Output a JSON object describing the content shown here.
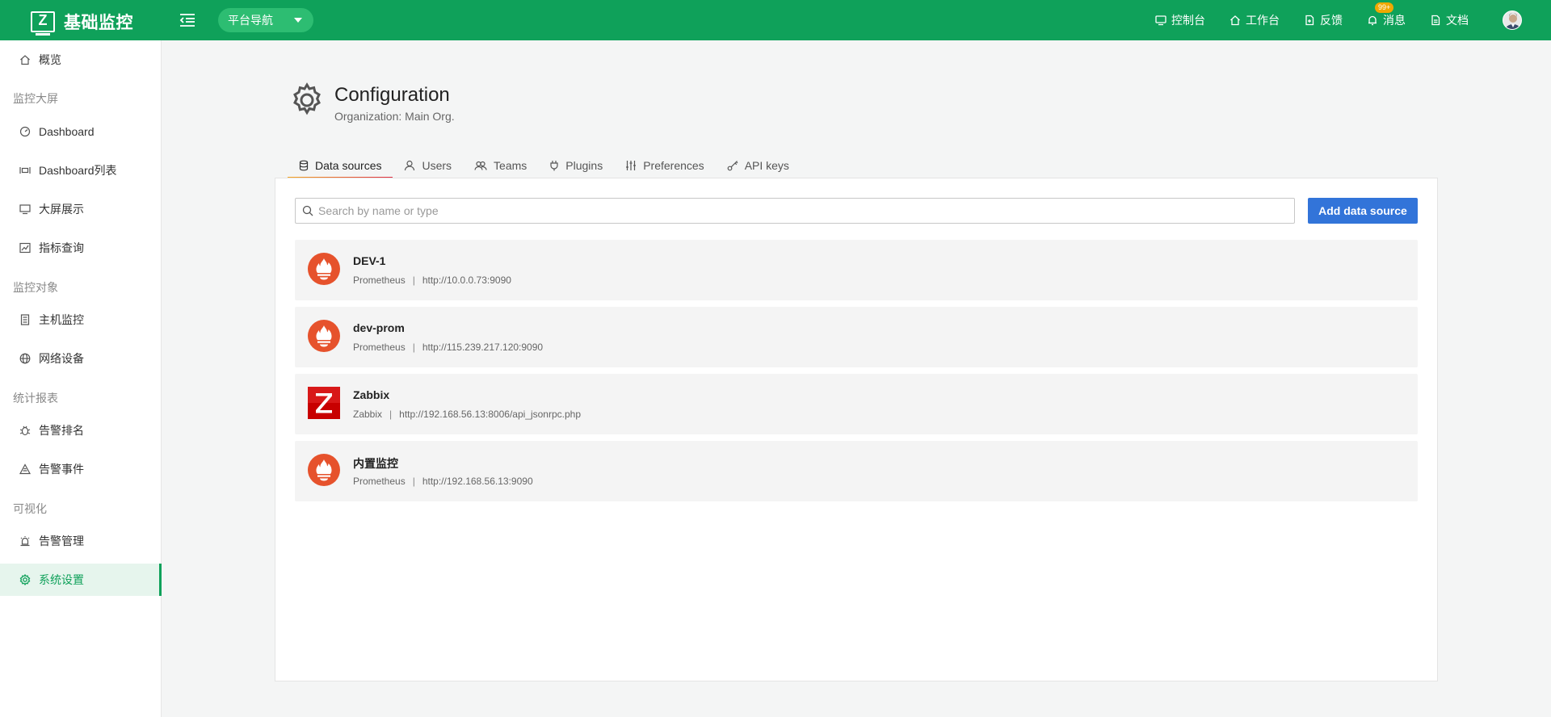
{
  "app": {
    "logo_letter": "Z",
    "title": "基础监控",
    "platform_nav": "平台导航"
  },
  "top_nav": [
    {
      "label": "控制台",
      "icon": "monitor-icon"
    },
    {
      "label": "工作台",
      "icon": "home-icon"
    },
    {
      "label": "反馈",
      "icon": "feedback-icon"
    },
    {
      "label": "消息",
      "icon": "bell-icon",
      "badge": "99+"
    },
    {
      "label": "文档",
      "icon": "document-icon"
    }
  ],
  "sidebar": {
    "overview": "概览",
    "groups": {
      "screens": "监控大屏",
      "objects": "监控对象",
      "reports": "统计报表",
      "visual": "可视化"
    },
    "items": {
      "dashboard": "Dashboard",
      "dashboard_list": "Dashboard列表",
      "big_screen": "大屏展示",
      "metrics": "指标查询",
      "host": "主机监控",
      "network": "网络设备",
      "alert_rank": "告警排名",
      "alert_events": "告警事件",
      "alert_manage": "告警管理",
      "settings": "系统设置"
    }
  },
  "page": {
    "title": "Configuration",
    "subtitle": "Organization: Main Org."
  },
  "tabs": [
    {
      "label": "Data sources",
      "icon": "database-icon",
      "active": true
    },
    {
      "label": "Users",
      "icon": "user-icon"
    },
    {
      "label": "Teams",
      "icon": "users-icon"
    },
    {
      "label": "Plugins",
      "icon": "plug-icon"
    },
    {
      "label": "Preferences",
      "icon": "sliders-icon"
    },
    {
      "label": "API keys",
      "icon": "key-icon"
    }
  ],
  "search": {
    "placeholder": "Search by name or type",
    "value": ""
  },
  "add_button": "Add data source",
  "datasources": [
    {
      "name": "DEV-1",
      "type": "Prometheus",
      "url": "http://10.0.0.73:9090",
      "icon": "prometheus-icon"
    },
    {
      "name": "dev-prom",
      "type": "Prometheus",
      "url": "http://115.239.217.120:9090",
      "icon": "prometheus-icon"
    },
    {
      "name": "Zabbix",
      "type": "Zabbix",
      "url": "http://192.168.56.13:8006/api_jsonrpc.php",
      "icon": "zabbix-icon"
    },
    {
      "name": "内置监控",
      "type": "Prometheus",
      "url": "http://192.168.56.13:9090",
      "icon": "prometheus-icon"
    }
  ],
  "meta_separator": "|",
  "colors": {
    "brand_green": "#0fa15a",
    "primary_blue": "#3274d9",
    "prometheus_orange": "#e6522c",
    "zabbix_red": "#d40000"
  }
}
